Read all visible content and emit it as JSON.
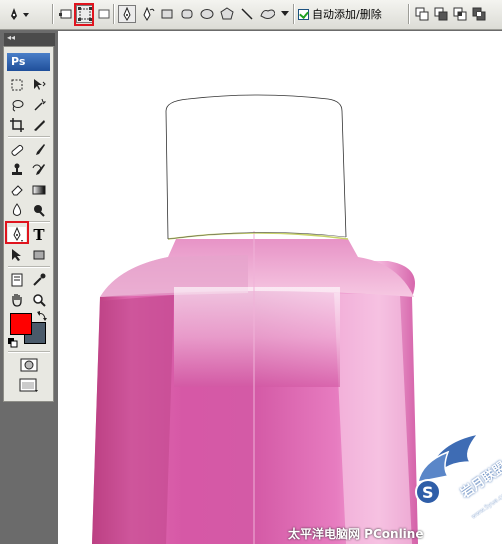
{
  "options_bar": {
    "auto_add_delete_label": "自动添加/删除",
    "auto_add_delete_checked": true,
    "tools": [
      "pen-tool-icon",
      "shape-layers-icon",
      "paths-icon",
      "fill-pixels-icon",
      "pen-icon",
      "freeform-pen-icon",
      "rectangle-icon",
      "rounded-rectangle-icon",
      "ellipse-icon",
      "polygon-icon",
      "line-icon",
      "custom-shape-icon",
      "dropdown-arrow-icon"
    ],
    "path_ops": [
      "add-to-path-icon",
      "subtract-from-path-icon",
      "intersect-path-icon",
      "exclude-overlap-icon"
    ]
  },
  "toolbox": {
    "logo": "Ps",
    "header_glyph": "◂◂",
    "type_tool_glyph": "T",
    "foreground_color": "#ff0000",
    "background_color": "#4a5a6a"
  },
  "canvas": {
    "watermark": "太平洋电脑网 PConline",
    "logo_text": "岩月联盟",
    "logo_sub": "www.5yue.com"
  },
  "colors": {
    "bottle_pink": "#d85aa6",
    "highlight": "#c8d26a",
    "selection_red": "#e0141e"
  }
}
